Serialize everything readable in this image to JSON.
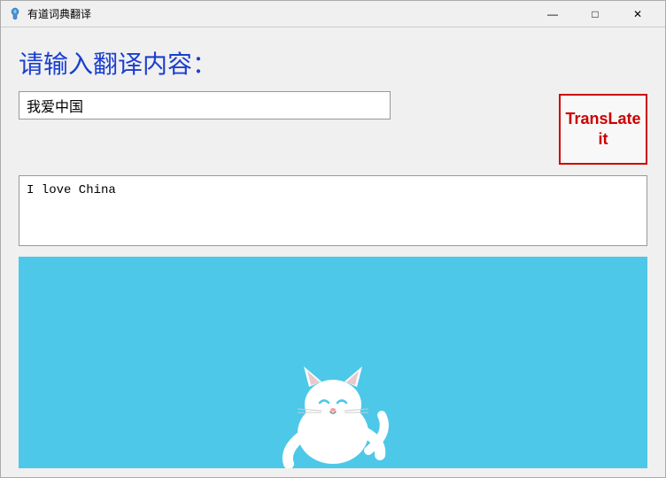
{
  "window": {
    "title": "有道词典翻译",
    "icon": "feather-icon"
  },
  "controls": {
    "minimize": "—",
    "maximize": "□",
    "close": "✕"
  },
  "main": {
    "prompt": "请输入翻译内容：",
    "input_value": "我爱中国",
    "input_placeholder": "",
    "translate_button_line1": "TransLate",
    "translate_button_line2": "it",
    "output_value": "I love China",
    "output_placeholder": ""
  }
}
